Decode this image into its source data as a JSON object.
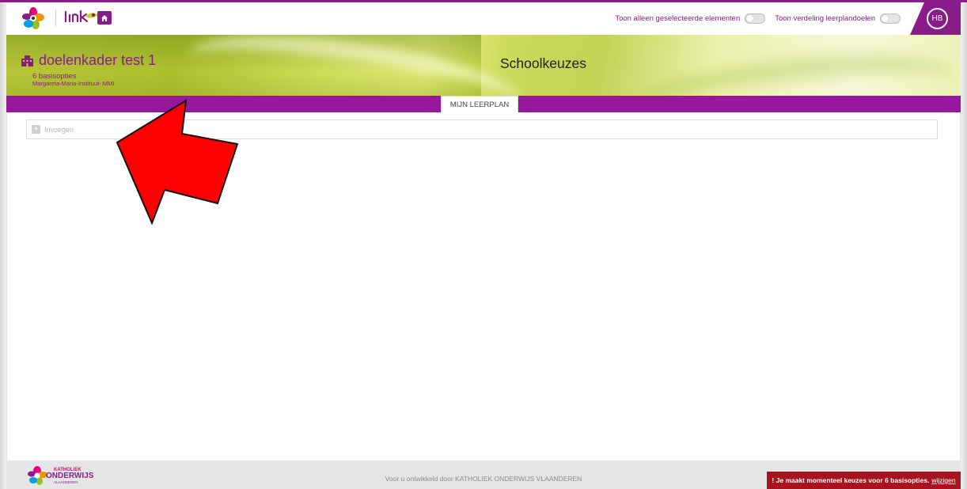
{
  "header": {
    "toggle1_label": "Toon alleen geselecteerde elementen",
    "toggle2_label": "Toon verdeling leerplandoelen",
    "avatar_initials": "HB",
    "brand_color": "#8a1c8a"
  },
  "banner": {
    "title": "doelenkader test 1",
    "subtitle": "6 basisopties",
    "school": "Margareta-Maria-Instituut- MMI",
    "page_heading": "Schoolkeuzes",
    "icon": "building-icon"
  },
  "tabs": [
    {
      "label": "MIJN LEERPLAN",
      "active": true
    }
  ],
  "content": {
    "insert_label": "Invoegen",
    "insert_icon": "plus-icon"
  },
  "annotation": {
    "arrow_color": "#ff0000"
  },
  "footer": {
    "logo_text_top": "KATHOLIEK",
    "logo_text_main": "ONDERWIJS",
    "logo_text_sub": "VLAANDEREN",
    "credit": "Voor u ontwikkeld door KATHOLIEK ONDERWIJS VLAANDEREN",
    "notice_text": "! Je maakt momenteel keuzes voor 6 basisopties.",
    "notice_link": "wijzigen",
    "notice_color": "#a7141f"
  }
}
